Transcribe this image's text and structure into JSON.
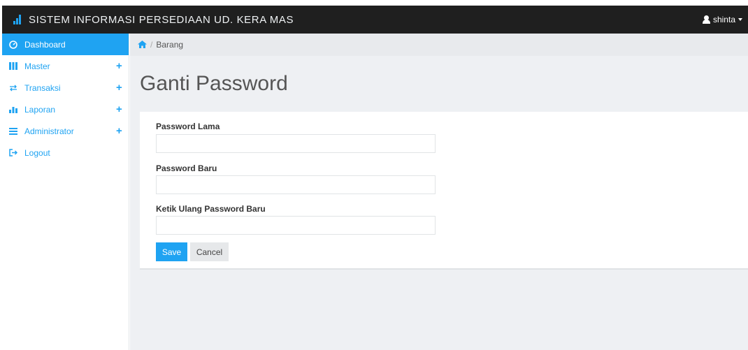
{
  "app": {
    "title": "SISTEM INFORMASI PERSEDIAAN UD. KERA MAS",
    "user_name": "shinta"
  },
  "sidebar": {
    "items": [
      {
        "label": "Dashboard",
        "icon": "dashboard-icon",
        "active": true
      },
      {
        "label": "Master",
        "icon": "grid-icon",
        "expandable": true
      },
      {
        "label": "Transaksi",
        "icon": "exchange-icon",
        "expandable": true
      },
      {
        "label": "Laporan",
        "icon": "bar-chart-icon",
        "expandable": true
      },
      {
        "label": "Administrator",
        "icon": "list-icon",
        "expandable": true
      },
      {
        "label": "Logout",
        "icon": "logout-icon"
      }
    ],
    "expand_symbol": "+"
  },
  "breadcrumb": {
    "separator": "/",
    "current": "Barang"
  },
  "page": {
    "title": "Ganti Password"
  },
  "form": {
    "old_password_label": "Password Lama",
    "old_password_value": "",
    "new_password_label": "Password Baru",
    "new_password_value": "",
    "confirm_password_label": "Ketik Ulang Password Baru",
    "confirm_password_value": "",
    "save_label": "Save",
    "cancel_label": "Cancel"
  },
  "colors": {
    "accent": "#1fa3f2",
    "navbar": "#1f1f1f",
    "content_bg": "#eef0f3"
  }
}
